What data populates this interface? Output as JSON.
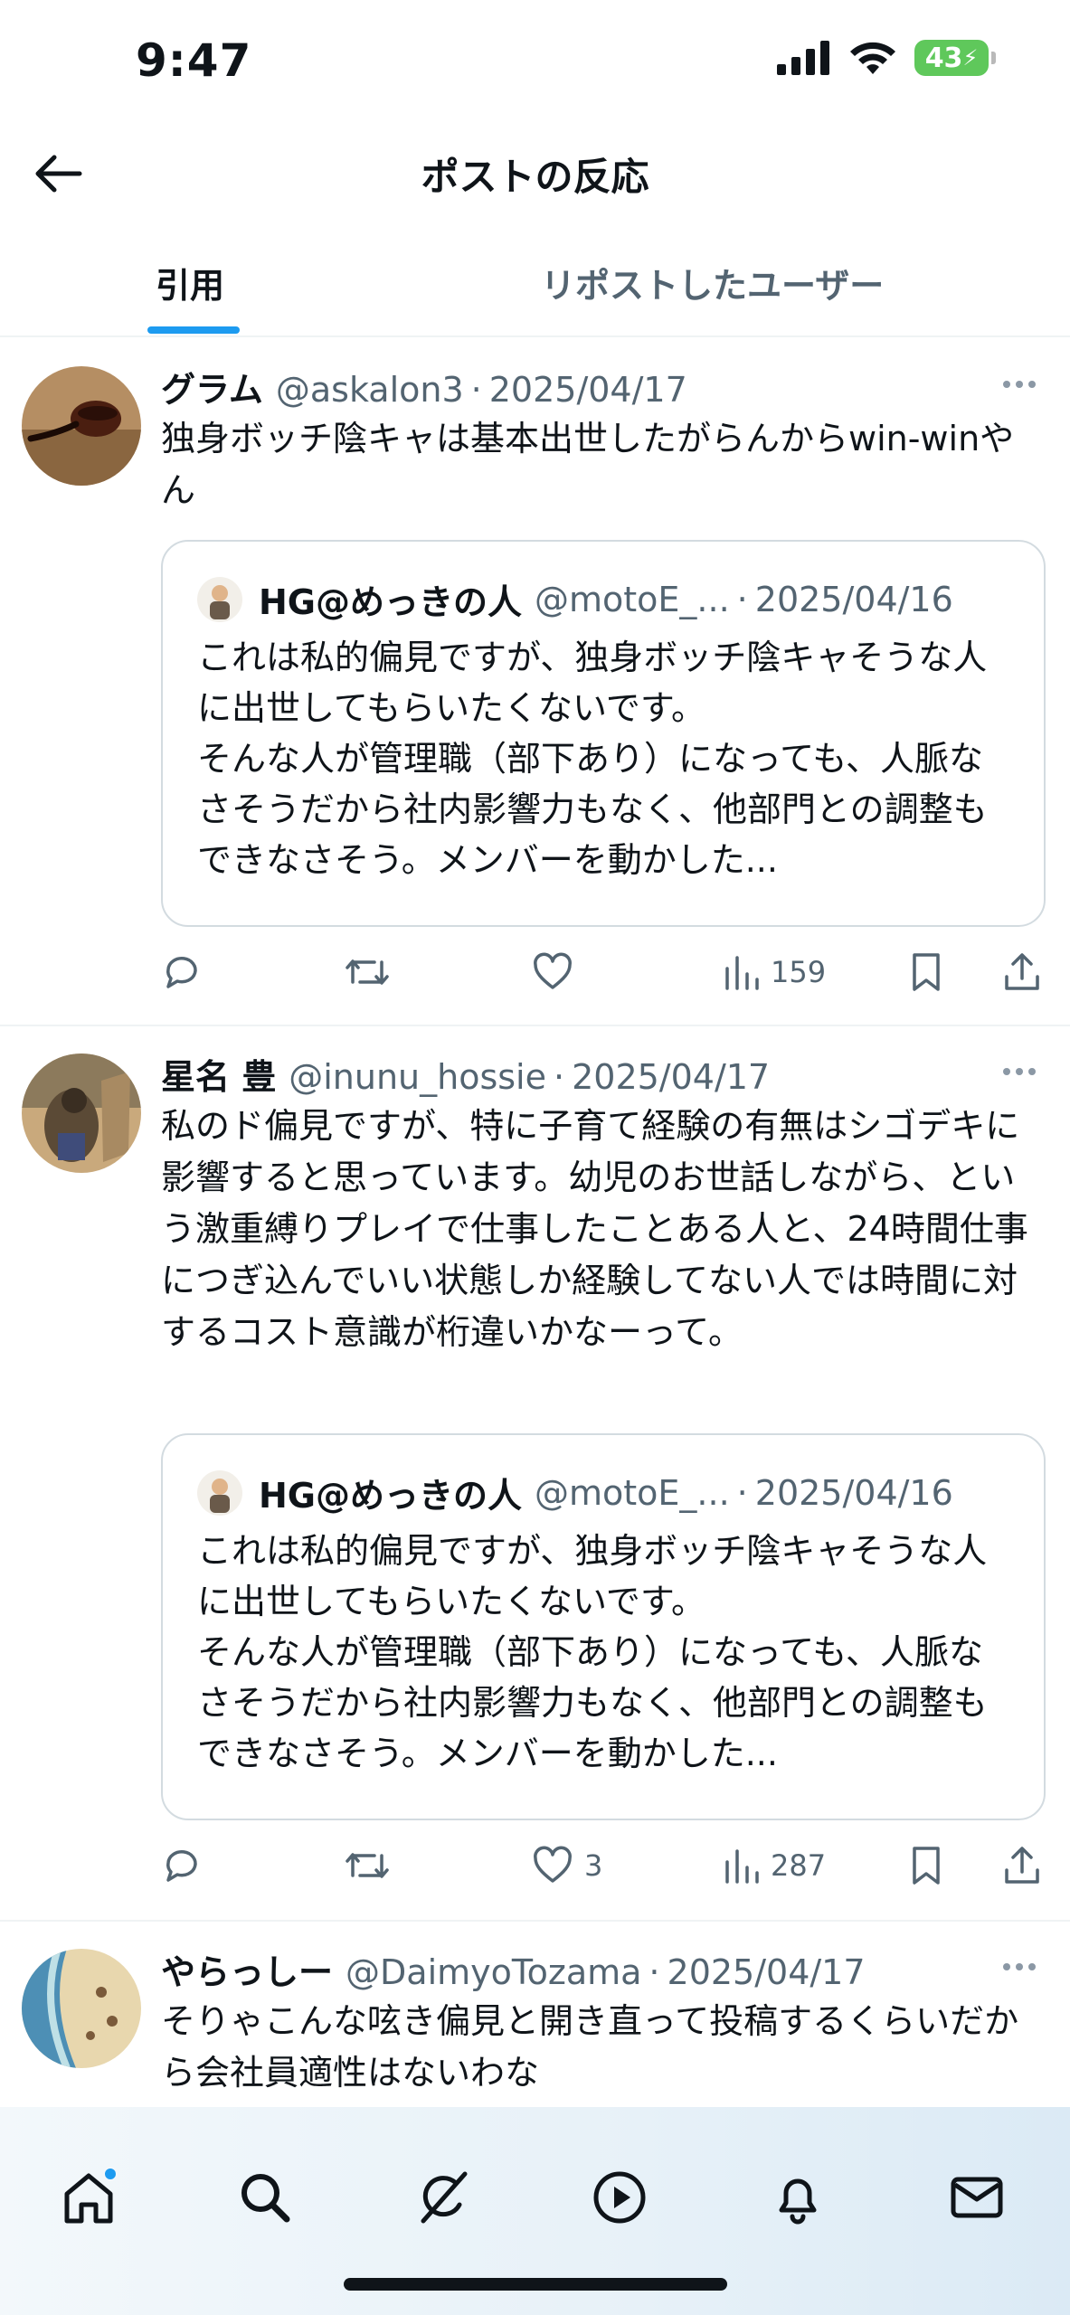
{
  "status_bar": {
    "time": "9:47",
    "battery": "43"
  },
  "header": {
    "title": "ポストの反応"
  },
  "tabs": [
    {
      "label": "引用",
      "active": true
    },
    {
      "label": "リポストしたユーザー",
      "active": false
    }
  ],
  "posts": [
    {
      "name": "グラム",
      "handle": "@askalon3",
      "date": "2025/04/17",
      "text": "独身ボッチ陰キャは基本出世したがらんからwin-winやん",
      "quote": {
        "name": "HG@めっきの人",
        "handle": "@motoE_...",
        "date": "2025/04/16",
        "text": "これは私的偏見ですが、独身ボッチ陰キャそうな人に出世してもらいたくないです。\nそんな人が管理職（部下あり）になっても、人脈なさそうだから社内影響力もなく、他部門との調整もできなさそう。メンバーを動かした..."
      },
      "likes": "",
      "views": "159"
    },
    {
      "name": "星名 豊",
      "handle": "@inunu_hossie",
      "date": "2025/04/17",
      "text": "私のド偏見ですが、特に子育て経験の有無はシゴデキに影響すると思っています。幼児のお世話しながら、という激重縛りプレイで仕事したことある人と、24時間仕事につぎ込んでいい状態しか経験してない人では時間に対するコスト意識が桁違いかなーって。",
      "quote": {
        "name": "HG@めっきの人",
        "handle": "@motoE_...",
        "date": "2025/04/16",
        "text": "これは私的偏見ですが、独身ボッチ陰キャそうな人に出世してもらいたくないです。\nそんな人が管理職（部下あり）になっても、人脈なさそうだから社内影響力もなく、他部門との調整もできなさそう。メンバーを動かした..."
      },
      "likes": "3",
      "views": "287"
    },
    {
      "name": "やらっしー",
      "handle": "@DaimyoTozama",
      "date": "2025/04/17",
      "text": "そりゃこんな呟き偏見と開き直って投稿するくらいだから会社員適性はないわな"
    }
  ],
  "nav": {
    "items": [
      {
        "icon": "home-icon"
      },
      {
        "icon": "search-icon"
      },
      {
        "icon": "grok-icon"
      },
      {
        "icon": "video-icon"
      },
      {
        "icon": "bell-icon"
      },
      {
        "icon": "mail-icon"
      }
    ]
  },
  "colors": {
    "accent": "#1d9bf0",
    "text": "#0f1419",
    "muted": "#536471",
    "border": "#eff3f4"
  }
}
